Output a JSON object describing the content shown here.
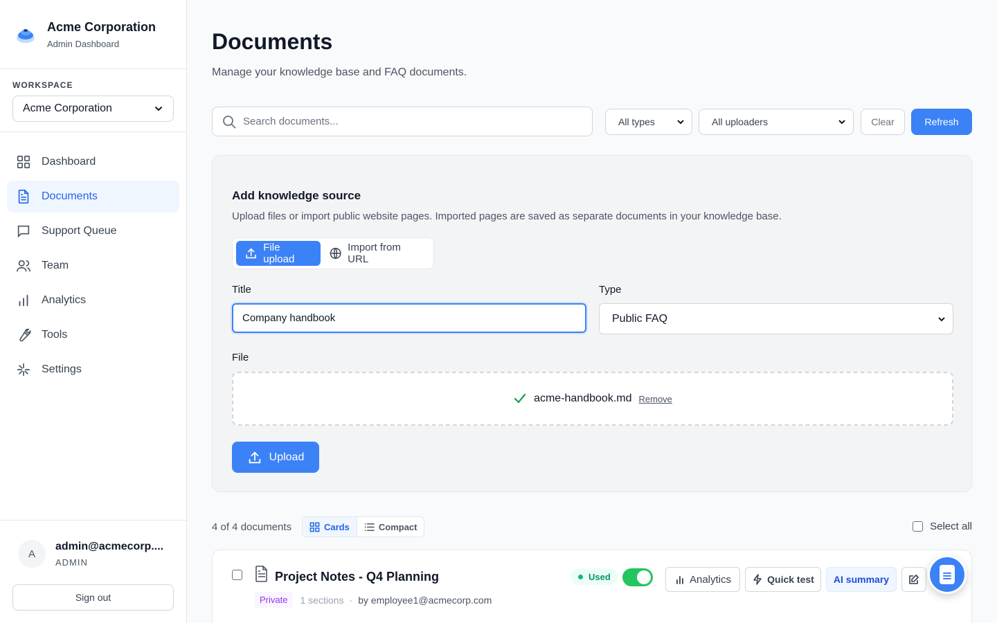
{
  "brand": {
    "name": "Acme Corporation",
    "subtitle": "Admin Dashboard"
  },
  "workspace": {
    "label": "WORKSPACE",
    "selected": "Acme Corporation"
  },
  "nav": [
    {
      "label": "Dashboard",
      "icon": "grid-icon",
      "active": false
    },
    {
      "label": "Documents",
      "icon": "document-icon",
      "active": true
    },
    {
      "label": "Support Queue",
      "icon": "chat-icon",
      "active": false
    },
    {
      "label": "Team",
      "icon": "users-icon",
      "active": false
    },
    {
      "label": "Analytics",
      "icon": "bar-chart-icon",
      "active": false
    },
    {
      "label": "Tools",
      "icon": "wrench-icon",
      "active": false
    },
    {
      "label": "Settings",
      "icon": "settings-icon",
      "active": false
    }
  ],
  "user": {
    "initial": "A",
    "email": "admin@acmecorp....",
    "role": "ADMIN",
    "signout": "Sign out"
  },
  "page": {
    "title": "Documents",
    "subtitle": "Manage your knowledge base and FAQ documents."
  },
  "filters": {
    "search_placeholder": "Search documents...",
    "type": "All types",
    "uploader": "All uploaders",
    "clear": "Clear",
    "refresh": "Refresh"
  },
  "add_source": {
    "title": "Add knowledge source",
    "subtitle": "Upload files or import public website pages. Imported pages are saved as separate documents in your knowledge base.",
    "tab_upload": "File upload",
    "tab_url": "Import from URL",
    "title_label": "Title",
    "title_value": "Company handbook",
    "type_label": "Type",
    "type_value": "Public FAQ",
    "file_label": "File",
    "file_name": "acme-handbook.md",
    "remove": "Remove",
    "upload": "Upload"
  },
  "list": {
    "count": "4 of 4 documents",
    "view_cards": "Cards",
    "view_compact": "Compact",
    "select_all": "Select all"
  },
  "document": {
    "title": "Project Notes - Q4 Planning",
    "visibility": "Private",
    "sections": "1 sections",
    "separator": "·",
    "by": "by employee1@acmecorp.com",
    "status": "Used",
    "analytics": "Analytics",
    "quick_test": "Quick test",
    "ai_summary": "AI summary"
  },
  "colors": {
    "primary": "#3b82f6",
    "active_bg": "#eff6ff",
    "success": "#22c55e",
    "private": "#9333ea"
  }
}
